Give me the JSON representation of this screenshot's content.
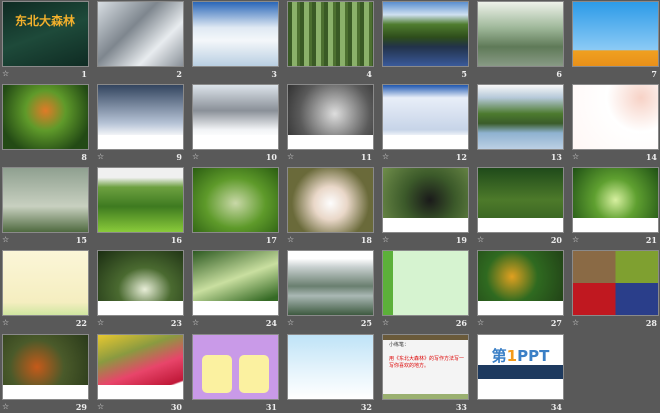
{
  "slides": [
    {
      "n": "1",
      "star": true,
      "title": "东北大森林",
      "bg": "linear-gradient(160deg,#0e2a22,#1e4a3a 50%,#0f2b23)"
    },
    {
      "n": "2",
      "star": false,
      "bg": "linear-gradient(135deg,#d7dde2,#7e868e 40%,#e8ecef 70%,#8a9199)"
    },
    {
      "n": "3",
      "star": false,
      "bg": "linear-gradient(180deg,#2a66b8,#dfe9f3 40%,#f4f7fa 60%,#b9cfe2)"
    },
    {
      "n": "4",
      "star": false,
      "bg": "repeating-linear-gradient(90deg,#3a5a25 0 4px,#8bb16a 4px 9px,#4d7030 9px 12px)"
    },
    {
      "n": "5",
      "star": false,
      "bg": "linear-gradient(180deg,#5a8fd0,#cfe0f0 20%,#4f7d2f 35%,#2e4d1b 55%,#22324a 70%,#3a5a9a)"
    },
    {
      "n": "6",
      "star": false,
      "bg": "linear-gradient(180deg,#eef2ea,#9fb89a 40%,#5f7a58 70%,#889a85)"
    },
    {
      "n": "7",
      "star": false,
      "bg": "linear-gradient(180deg,#2c9be8,#8ccaf5 75%,#f0a020 76%,#e8901a)"
    },
    {
      "n": "8",
      "star": false,
      "bg": "radial-gradient(circle at 50% 40%,#e07a28,#5f9a2a 35%,#234a15 80%)"
    },
    {
      "n": "9",
      "star": true,
      "bg": "linear-gradient(180deg,#33455f,#b6c3d6 60%,#ffffff 82%)",
      "cap": true
    },
    {
      "n": "10",
      "star": true,
      "bg": "linear-gradient(180deg,#dce3ea,#8a9098 40%,#f2f4f6 70%,#fff 82%)",
      "cap": true
    },
    {
      "n": "11",
      "star": true,
      "bg": "radial-gradient(circle at 55% 45%,#dedede,#5a5a5a 60%,#2b2b2b)",
      "cap": true
    },
    {
      "n": "12",
      "star": true,
      "bg": "linear-gradient(180deg,#1f57b0,#e8eef8 20%,#c7d4e8 70%,#fff 82%)",
      "cap": true
    },
    {
      "n": "13",
      "star": false,
      "bg": "linear-gradient(180deg,#f8f8f8,#b5c8d8 20%,#4c7a2e 45%,#3a5c2a 60%,#8fb2d0 75%,#bcd0e4)"
    },
    {
      "n": "14",
      "star": true,
      "bg": "radial-gradient(circle at 80% 20%,#f7d2c6,#fff 40%,#fff7f5)"
    },
    {
      "n": "15",
      "star": true,
      "bg": "linear-gradient(180deg,#8fa090,#c8d0c0 60%,#4f6a40)"
    },
    {
      "n": "16",
      "star": false,
      "bg": "linear-gradient(180deg,#f0f0f0 15%,#6da040 30%,#3e7a20 60%,#8acb3a)"
    },
    {
      "n": "17",
      "star": false,
      "bg": "radial-gradient(ellipse at 50% 55%,#c9d8a8,#5e9a2a 50%,#2b5d12)"
    },
    {
      "n": "18",
      "star": true,
      "bg": "radial-gradient(circle at 50% 55%,#fdfdfd,#e9d7c8 30%,#6a6a3a 70%)"
    },
    {
      "n": "19",
      "star": true,
      "bg": "radial-gradient(circle at 55% 50%,#1a1a1a,#3c5a2a 45%,#6f8d4a)",
      "cap": true
    },
    {
      "n": "20",
      "star": true,
      "bg": "linear-gradient(180deg,#1f4a1a,#4d7a2a 50%,#2f5a1f)",
      "cap": true
    },
    {
      "n": "21",
      "star": true,
      "bg": "radial-gradient(circle at 50% 50%,#d7f0a0,#5fa030 40%,#1f5015)",
      "cap": true
    },
    {
      "n": "22",
      "star": true,
      "bg": "linear-gradient(180deg,#fbf6d8,#f5eec0 80%,#cfe6a0)"
    },
    {
      "n": "23",
      "star": true,
      "bg": "radial-gradient(ellipse at 55% 60%,#e8eed8,#4a6a30 40%,#1b2d12)",
      "cap": true
    },
    {
      "n": "24",
      "star": true,
      "bg": "linear-gradient(160deg,#2d5a22,#c9dfa0 45%,#356a25 80%)",
      "cap": true
    },
    {
      "n": "25",
      "star": true,
      "bg": "linear-gradient(180deg,#fefefe 12%,#c8d0d0 25%,#6a7f70 55%,#aab8b4 70%,#3e5a40)"
    },
    {
      "n": "26",
      "star": true,
      "bg": "linear-gradient(90deg,#5cb03a 0 12%,#d6f3d0 12%)"
    },
    {
      "n": "27",
      "star": true,
      "bg": "radial-gradient(circle at 40% 40%,#e0a020,#2f6a20 40%,#1f3a15)",
      "cap": true
    },
    {
      "n": "28",
      "star": true,
      "bg": "conic-gradient(from 0deg at 50% 50%,#7fa030 0 25%,#2a3e8a 25% 50%,#c01820 50% 75%,#8a6a45 75%)"
    },
    {
      "n": "29",
      "star": true,
      "bg": "radial-gradient(circle at 40% 50%,#c55a1a,#4a5a2a 45%,#2a3a1a)",
      "cap": true
    },
    {
      "n": "30",
      "star": true,
      "bg": "linear-gradient(160deg,#e8c830,#8a9a40 30%,#e8456a 55%,#c01838 80%,#fff 82%)",
      "cap": true
    },
    {
      "n": "31",
      "star": false,
      "bg": "#c99ae8",
      "boxes": true
    },
    {
      "n": "32",
      "star": false,
      "bg": "linear-gradient(180deg,#bfe3f7,#e8f5fc 60%,#fff)"
    },
    {
      "n": "33",
      "star": false,
      "bg": "linear-gradient(180deg,#6a5a3a 0 8%,#f4f4f4 8% 92%,#9ab070 92%)",
      "header": "小练笔：",
      "note": "用《东北大森林》的写作方法写一写你喜欢的地方。"
    },
    {
      "n": "34",
      "star": false,
      "bg": "#ffffff",
      "logo_pre": "第",
      "logo_num": "1",
      "logo_post": "PPT"
    }
  ]
}
